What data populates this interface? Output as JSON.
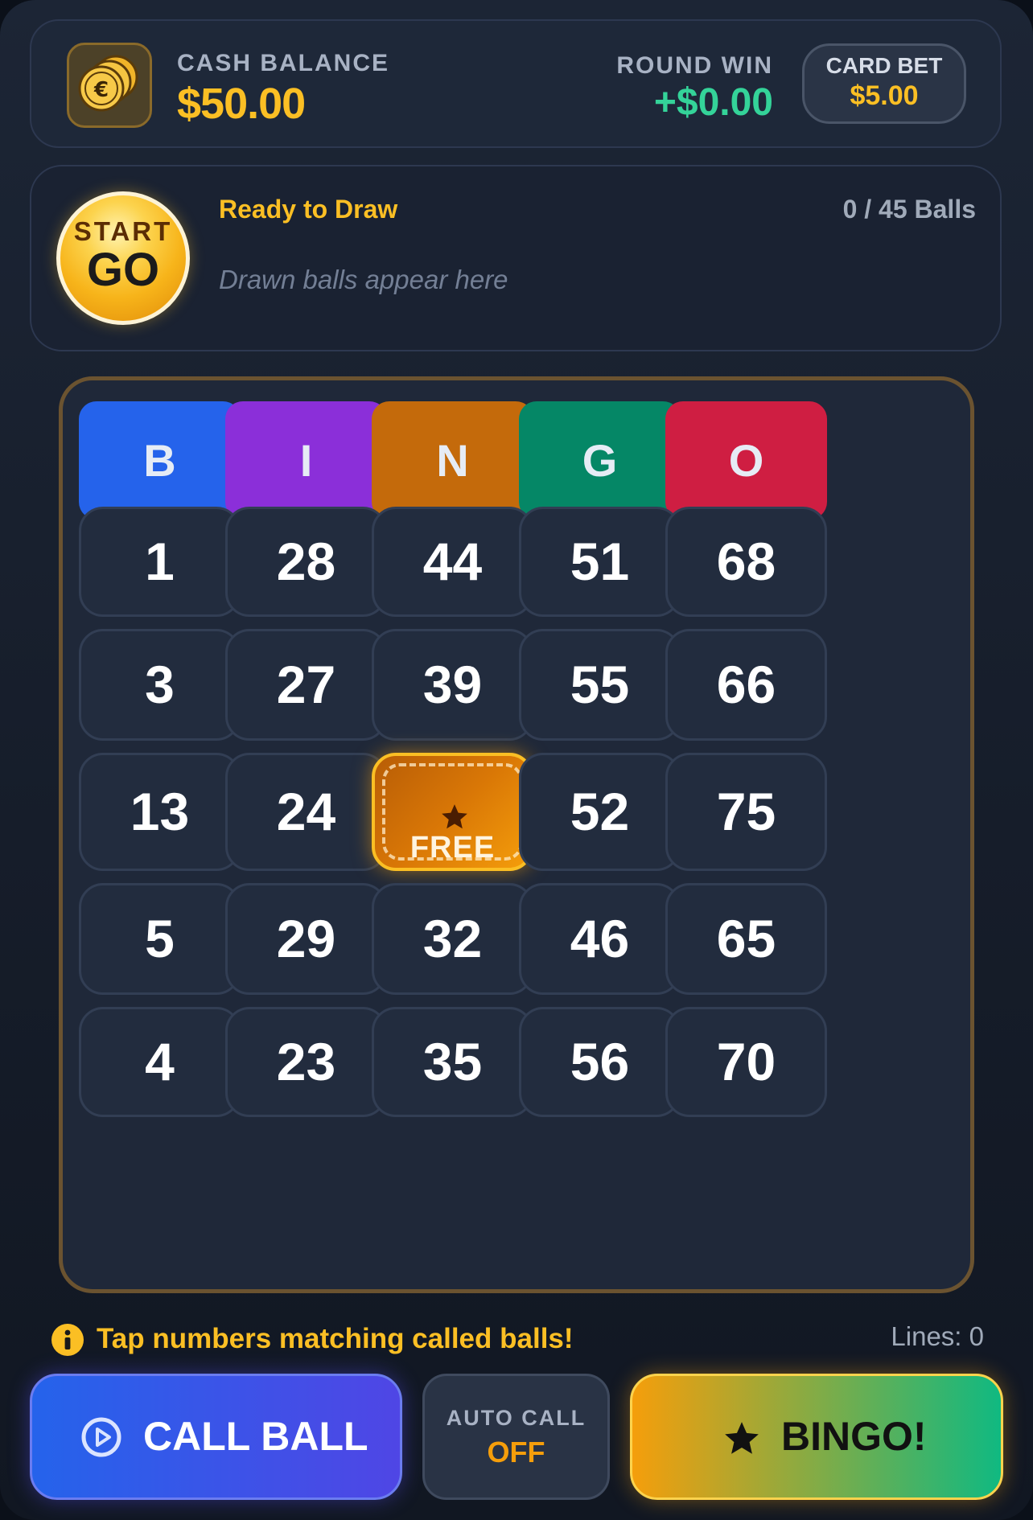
{
  "balance": {
    "label": "CASH BALANCE",
    "value": "$50.00",
    "icon": "euro-coins-icon"
  },
  "round_win": {
    "label": "ROUND WIN",
    "value": "+$0.00"
  },
  "card_bet": {
    "label": "CARD BET",
    "value": "$5.00"
  },
  "draw": {
    "start_label": "START",
    "go_label": "GO",
    "status": "Ready to Draw",
    "count": "0 / 45 Balls",
    "placeholder": "Drawn balls appear here"
  },
  "board": {
    "headers": [
      {
        "letter": "B",
        "color": "#2563eb"
      },
      {
        "letter": "I",
        "color": "#8b2fd9"
      },
      {
        "letter": "N",
        "color": "#c46a0b"
      },
      {
        "letter": "G",
        "color": "#058766"
      },
      {
        "letter": "O",
        "color": "#cf1e42"
      }
    ],
    "rows": [
      [
        "1",
        "28",
        "44",
        "51",
        "68"
      ],
      [
        "3",
        "27",
        "39",
        "55",
        "66"
      ],
      [
        "13",
        "24",
        "FREE",
        "52",
        "75"
      ],
      [
        "5",
        "29",
        "32",
        "46",
        "65"
      ],
      [
        "4",
        "23",
        "35",
        "56",
        "70"
      ]
    ],
    "free_label": "FREE"
  },
  "footer": {
    "hint": "Tap numbers matching called balls!",
    "lines": "Lines: 0",
    "call_ball": "CALL BALL",
    "auto_call_label": "AUTO CALL",
    "auto_call_value": "OFF",
    "bingo": "BINGO!"
  },
  "colors": {
    "accent": "#fbbf24",
    "win": "#34d399",
    "panel": "#1e2839"
  }
}
